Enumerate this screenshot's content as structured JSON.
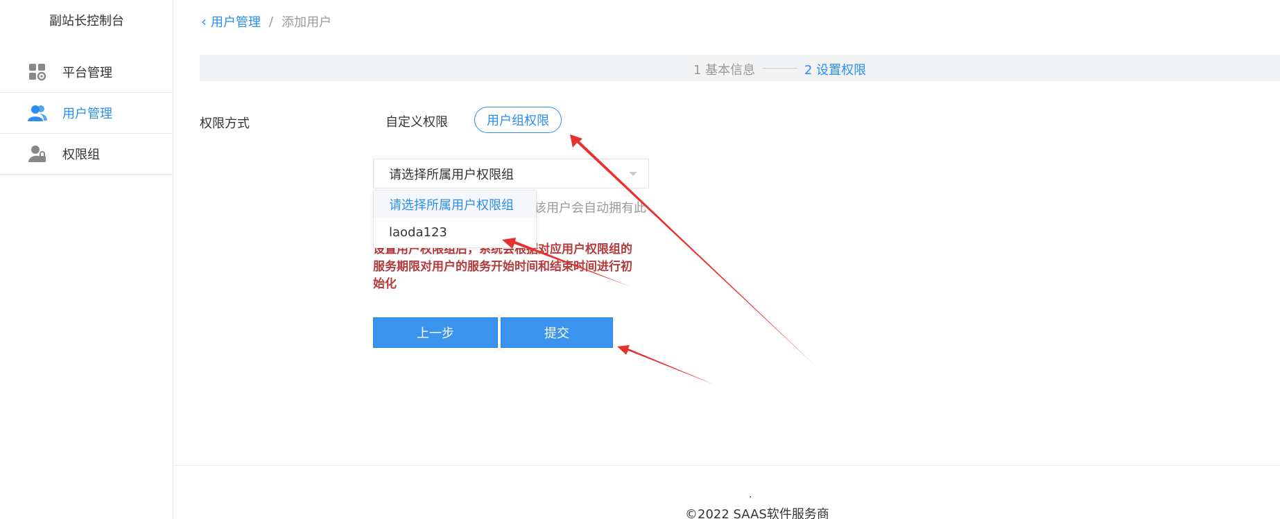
{
  "sidebar": {
    "title": "副站长控制台",
    "items": [
      {
        "label": "平台管理",
        "icon": "grid-gear-icon",
        "active": false
      },
      {
        "label": "用户管理",
        "icon": "users-icon",
        "active": true
      },
      {
        "label": "权限组",
        "icon": "user-lock-icon",
        "active": false
      }
    ]
  },
  "breadcrumb": {
    "back": "用户管理",
    "separator": "/",
    "current": "添加用户"
  },
  "steps": {
    "step1": "1 基本信息",
    "step2": "2 设置权限"
  },
  "form": {
    "permission_label": "权限方式",
    "option_custom": "自定义权限",
    "option_group": "用户组权限",
    "select_value": "请选择所属用户权限组",
    "hint_fragment": "该用户会自动拥有此",
    "dropdown_options": [
      "请选择所属用户权限组",
      "laoda123"
    ],
    "warning": "设置用户权限组后，系统会根据对应用户权限组的服务期限对用户的服务开始时间和结束时间进行初始化",
    "prev_button": "上一步",
    "submit_button": "提交"
  },
  "footer": {
    "dot": ".",
    "copyright": "©2022 SAAS软件服务商"
  },
  "colors": {
    "accent": "#2a8ef0",
    "warning": "#b53a3a",
    "annotation_arrow": "#e8312e"
  }
}
